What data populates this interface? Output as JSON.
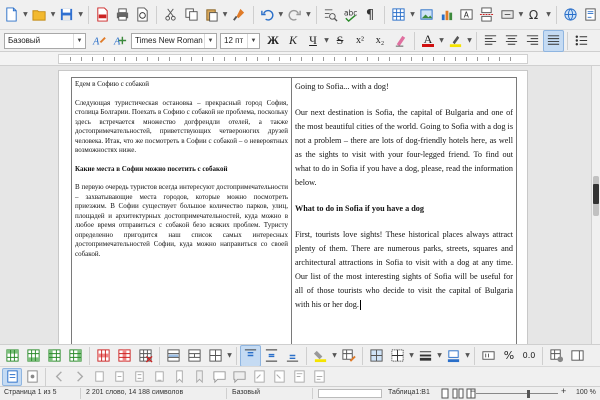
{
  "toolbar_std": {
    "icons": [
      "new-document-icon",
      "open-folder-icon",
      "save-icon",
      "export-pdf-icon",
      "print-icon",
      "print-preview-icon",
      "cut-icon",
      "copy-icon",
      "paste-icon",
      "clone-formatting-icon",
      "undo-icon",
      "redo-icon",
      "find-replace-icon",
      "spelling-icon",
      "formatting-marks-icon",
      "insert-table-icon",
      "insert-image-icon",
      "insert-chart-icon",
      "insert-textbox-icon",
      "page-break-icon",
      "insert-field-icon",
      "special-character-icon",
      "hyperlink-icon",
      "footnote-icon"
    ]
  },
  "toolbar_format": {
    "paragraph_style": "Базовый",
    "font_name": "Times New Roman",
    "font_size": "12 пт",
    "bold": "Ж",
    "italic": "К",
    "underline": "Ч",
    "strike": "S",
    "superscript": "x²",
    "subscript": "x₂",
    "font_color_letter": "A",
    "font_color": "#d01010",
    "highlight_color": "#f5e400"
  },
  "document": {
    "left": {
      "title": "Едем в Софию с собакой",
      "p1": "Следующая туристическая остановка – прекрасный город София, столица Болгарии. Поехать в Софию с собакой не проблема, поскольку здесь встречается множество догфрендли отелей, а также достопримечательностей, приветствующих четвероногих друзей человека. Итак, что же посмотреть в Софии с собакой – о невероятных возможностях ниже.",
      "heading": "Какие места в Софии можно посетить с собакой",
      "p2": "В первую очередь туристов всегда интересуют достопримечательности – захватывающие места городов, которые можно посмотреть приезжим. В Софии существует большое количество парков, улиц, площадей и архитектурных достопримечательностей, куда можно в любое время отправиться с собакой безо всяких проблем. Туристу определенно пригодится наш список самых интересных достопримечательностей Софии, куда можно направиться со своей собакой."
    },
    "right": {
      "title": "Going to Sofia... with a dog!",
      "p1": "Our next destination is Sofia, the capital of Bulgaria and one of the most beautiful cities of the world. Going to Sofia with a dog is not a problem – there are lots of dog-friendly hotels here, as well as the sights to visit with your four-legged friend. To find out what to do in Sofia if you have a dog, please, read the information below.",
      "heading": "What to do in Sofia if you have a dog",
      "p2": "First, tourists love sights! These historical places always attract plenty of them. There are numerous parks, streets, squares and architectural attractions in Sofia to visit with a dog at any time. Our list of the most interesting sights of Sofia will be useful for all of those tourists who decide to visit the capital of Bulgaria with his or her dog."
    }
  },
  "toolbar_table": {
    "icons": [
      "insert-rows-above-icon",
      "insert-rows-below-icon",
      "insert-columns-before-icon",
      "insert-columns-after-icon",
      "delete-rows-icon",
      "delete-columns-icon",
      "delete-table-icon",
      "merge-cells-icon",
      "split-cells-icon",
      "optimize-size-icon",
      "align-top-icon",
      "center-vertically-icon",
      "align-bottom-icon",
      "table-cell-background-icon",
      "autoformat-styles-icon",
      "select-table-icon",
      "borders-icon",
      "border-style-icon",
      "border-color-icon",
      "number-format-icon",
      "percent-format-icon",
      "decimal-format-icon",
      "table-properties-icon",
      "sidebar-toggle-icon"
    ],
    "percent_label": "%",
    "decimal_label": "0.0"
  },
  "toolbar_nav": {
    "icons": [
      "navigator-icon",
      "page-preview-icon",
      "previous-page-icon",
      "next-page-icon",
      "first-object-icon",
      "previous-object-icon",
      "next-object-icon",
      "last-object-icon",
      "previous-bookmark-icon",
      "next-bookmark-icon",
      "previous-comment-icon",
      "next-comment-icon",
      "previous-track-change-icon",
      "next-track-change-icon",
      "previous-index-icon",
      "next-index-icon"
    ]
  },
  "status": {
    "page": "Страница 1 из 5",
    "words": "2 201 слово, 14 188 символов",
    "page_style": "Базовый",
    "table": "Таблица1:B1",
    "zoom": "100 %",
    "zoom_level": 1.0
  }
}
